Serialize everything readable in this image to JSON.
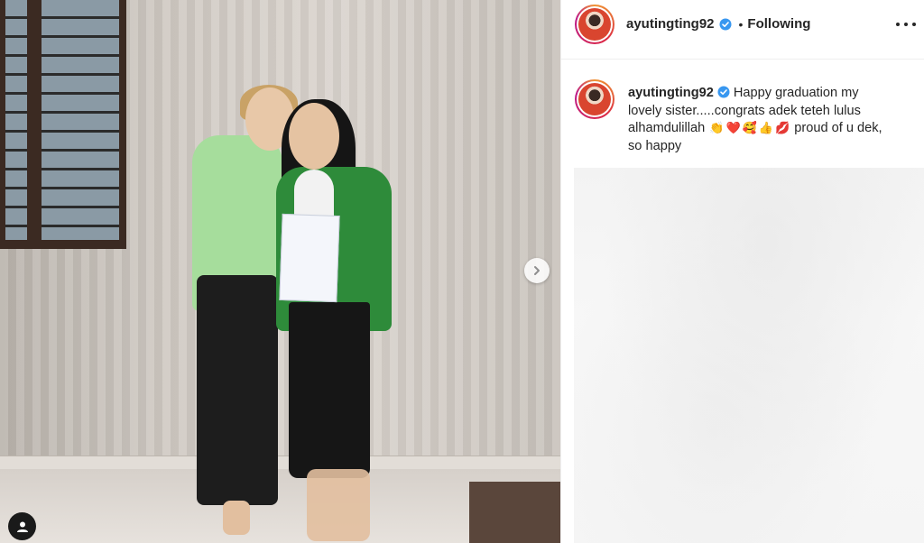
{
  "post": {
    "author": {
      "username": "ayutingting92",
      "verified": true,
      "follow_state": "Following",
      "separator": "•"
    },
    "caption": {
      "text_part1": "Happy graduation my lovely sister.....congrats adek teteh lulus alhamdulillah",
      "emojis": [
        "👏",
        "❤️",
        "🥰",
        "👍",
        "💋"
      ],
      "text_part2": "proud of u dek, so happy"
    },
    "media": {
      "next_icon": "chevron-right-icon",
      "tag_icon": "user-tag-icon"
    }
  },
  "colors": {
    "verified_blue": "#3897f0",
    "text_primary": "#262626",
    "border": "#efefef"
  }
}
